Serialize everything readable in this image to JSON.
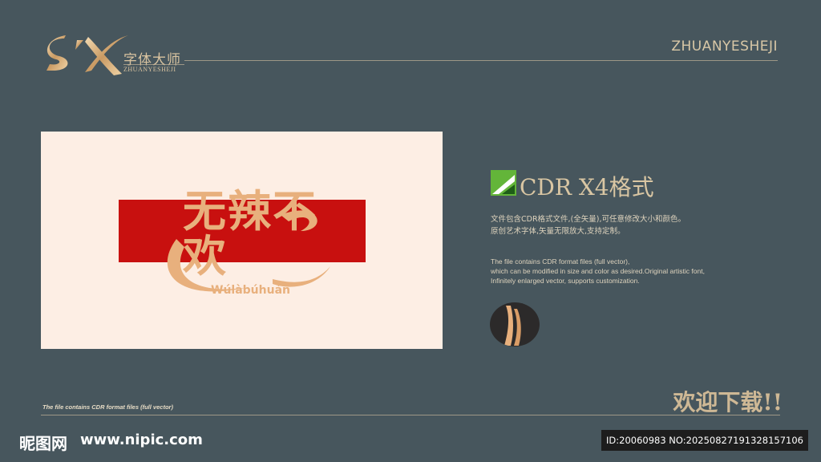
{
  "header": {
    "logo_cn": "字体大师",
    "logo_en": "ZHUANYESHEJI",
    "brand_right": "ZHUANYESHEJI"
  },
  "artwork": {
    "chinese_text": "无辣不欢",
    "pinyin": "Wúlàbúhuán",
    "colors": {
      "panel": "#fdeee4",
      "bar": "#c8100f",
      "gold": "#e8b07d"
    }
  },
  "info": {
    "format_title": "CDR X4格式",
    "cn_lines": [
      "文件包含CDR格式文件,(全矢量),可任意修改大小和颜色。",
      "原创艺术字体,矢量无限放大,支持定制。"
    ],
    "en_lines": [
      "The file contains CDR format files (full vector),",
      " which can be modified in size and color as desired.Original artistic font,",
      "Infinitely enlarged vector, supports customization."
    ]
  },
  "footer": {
    "note": "The file contains CDR format files (full vector)",
    "welcome": "欢迎下载!!",
    "site_cn": "昵图网",
    "site_url": "www.nipic.com",
    "id_text": "ID:20060983 NO:20250827191328157106"
  }
}
